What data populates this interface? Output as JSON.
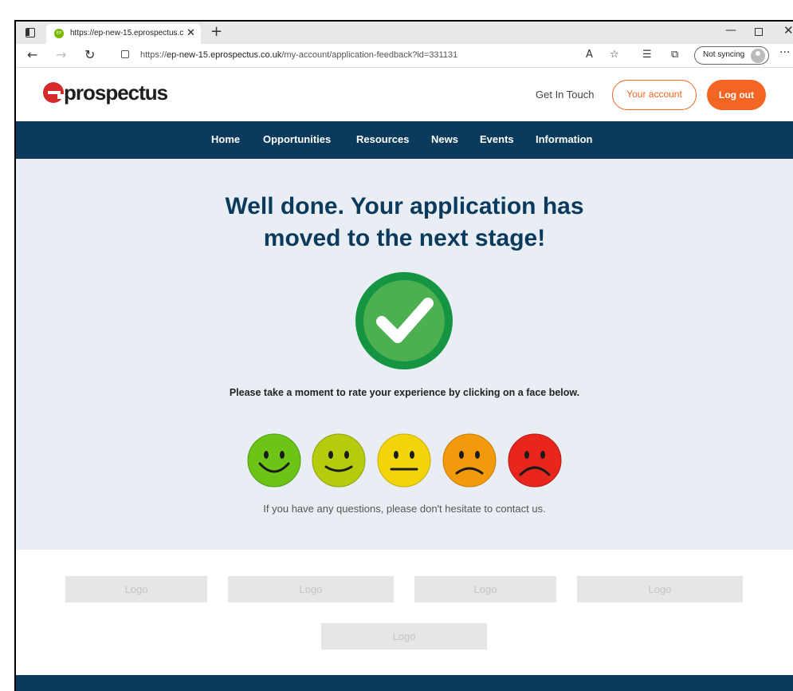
{
  "browser": {
    "tab_title": "https://ep-new-15.eprospectus.c",
    "favicon_text": "EP",
    "url_prefix": "https://",
    "url_host": "ep-new-15.eprospectus.co.uk",
    "url_path": "/my-account/application-feedback?id=331131",
    "sync_label": "Not syncing"
  },
  "header": {
    "logo_text": "prospectus",
    "get_in_touch": "Get In Touch",
    "your_account": "Your account",
    "log_out": "Log out"
  },
  "nav": {
    "items": [
      "Home",
      "Opportunities",
      "Resources",
      "News",
      "Events",
      "Information"
    ]
  },
  "hero": {
    "title_line1": "Well done. Your application has",
    "title_line2": "moved to the next stage!",
    "rate_prompt": "Please take a moment to rate your experience by clicking on a face below.",
    "contact": "If you have any questions, please don't hesitate to contact us."
  },
  "faces": [
    {
      "name": "very-happy",
      "color": "#6cc417"
    },
    {
      "name": "happy",
      "color": "#b5cc0e"
    },
    {
      "name": "neutral",
      "color": "#f2d40a"
    },
    {
      "name": "sad",
      "color": "#f29a0c"
    },
    {
      "name": "very-sad",
      "color": "#e8261c"
    }
  ],
  "logos": [
    "Logo",
    "Logo",
    "Logo",
    "Logo",
    "Logo"
  ],
  "colors": {
    "brand_navy": "#0b3a5d",
    "accent_orange": "#f26522",
    "success_green": "#4caf50"
  }
}
